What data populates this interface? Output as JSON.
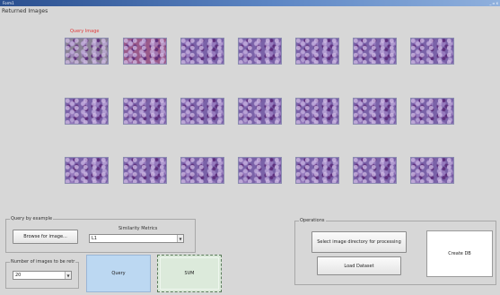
{
  "window": {
    "title": "Form1",
    "controls": "_ ▫ x"
  },
  "results": {
    "group_label": "Returned Images",
    "query_caption": "Query Image"
  },
  "query_by_sample": {
    "group_title": "Query by example",
    "browse_label": "Browse for image...",
    "similarity_label": "Similarity Metrics",
    "similarity_value": "L1"
  },
  "retrieval": {
    "group_title": "Number of images to be retr",
    "count_value": "20"
  },
  "actions": {
    "query_label": "Query",
    "svm_label": "SVM"
  },
  "operations": {
    "group_title": "Operations",
    "select_dir_label": "Select image directory for processing",
    "load_dataset_label": "Load Dataset",
    "create_db_label": "Create DB"
  }
}
